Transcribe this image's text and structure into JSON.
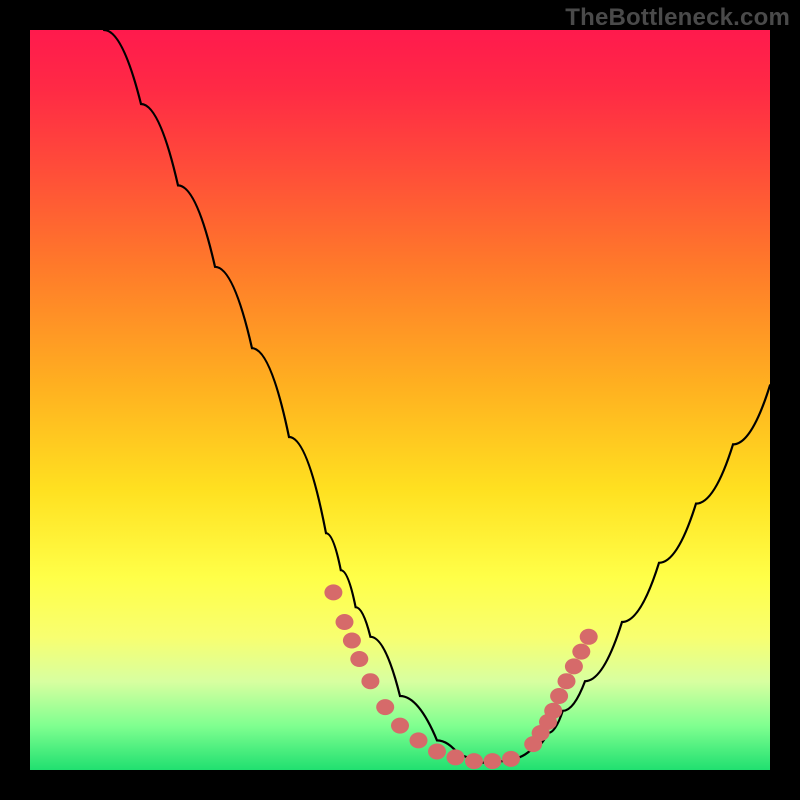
{
  "watermark": "TheBottleneck.com",
  "chart_data": {
    "type": "line",
    "title": "",
    "xlabel": "",
    "ylabel": "",
    "xlim": [
      0,
      100
    ],
    "ylim": [
      0,
      100
    ],
    "grid": false,
    "legend": false,
    "series": [
      {
        "name": "curve",
        "color": "#000000",
        "x": [
          10,
          15,
          20,
          25,
          30,
          35,
          40,
          42,
          44,
          46,
          50,
          55,
          58,
          60,
          62,
          65,
          68,
          70,
          72,
          75,
          80,
          85,
          90,
          95,
          100
        ],
        "y": [
          100,
          90,
          79,
          68,
          57,
          45,
          32,
          27,
          22,
          18,
          10,
          4,
          2,
          1,
          1,
          1.5,
          3,
          5,
          8,
          12,
          20,
          28,
          36,
          44,
          52
        ]
      }
    ],
    "markers": [
      {
        "name": "left-cluster",
        "color": "#d66a6a",
        "x": [
          41,
          42.5,
          43.5,
          44.5,
          46,
          48,
          50,
          52.5,
          55,
          57.5,
          60,
          62.5,
          65
        ],
        "y": [
          24,
          20,
          17.5,
          15,
          12,
          8.5,
          6,
          4,
          2.5,
          1.7,
          1.2,
          1.2,
          1.5
        ]
      },
      {
        "name": "right-cluster",
        "color": "#d66a6a",
        "x": [
          68,
          69,
          70,
          70.7,
          71.5,
          72.5,
          73.5,
          74.5,
          75.5
        ],
        "y": [
          3.5,
          5,
          6.5,
          8,
          10,
          12,
          14,
          16,
          18
        ]
      }
    ],
    "gradient_stops": [
      {
        "pos": 0.0,
        "color": "#ff1a4d"
      },
      {
        "pos": 0.08,
        "color": "#ff2a45"
      },
      {
        "pos": 0.18,
        "color": "#ff4a3a"
      },
      {
        "pos": 0.32,
        "color": "#ff7a2a"
      },
      {
        "pos": 0.48,
        "color": "#ffb020"
      },
      {
        "pos": 0.62,
        "color": "#ffe020"
      },
      {
        "pos": 0.74,
        "color": "#ffff48"
      },
      {
        "pos": 0.82,
        "color": "#f8ff70"
      },
      {
        "pos": 0.88,
        "color": "#d8ffa0"
      },
      {
        "pos": 0.94,
        "color": "#80ff90"
      },
      {
        "pos": 1.0,
        "color": "#20e070"
      }
    ]
  }
}
